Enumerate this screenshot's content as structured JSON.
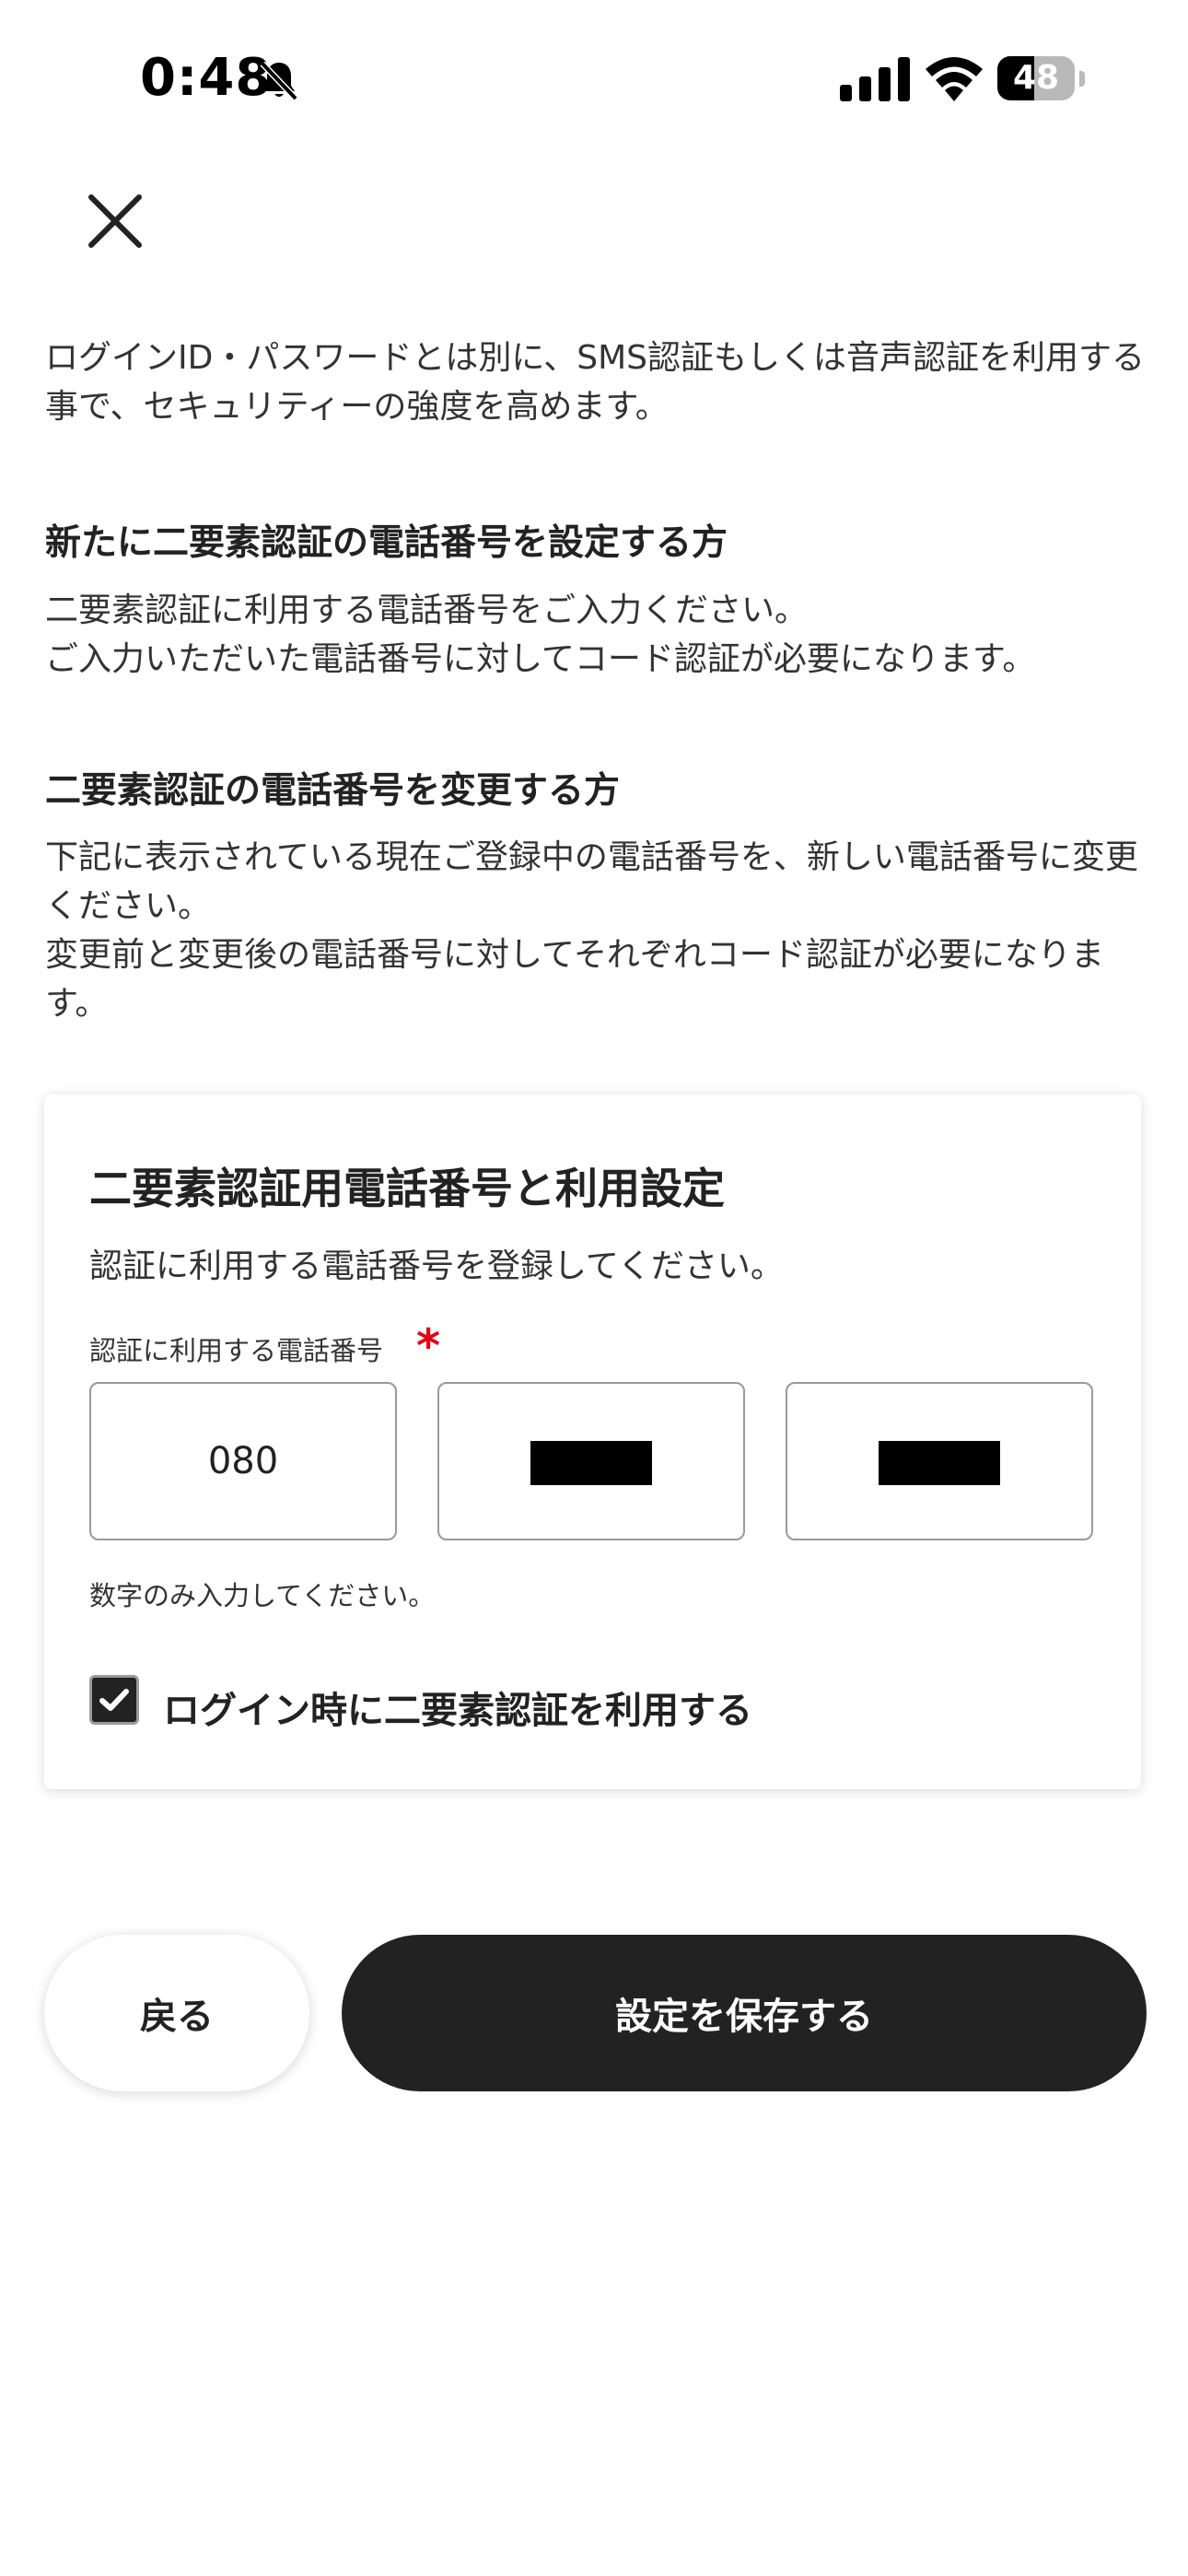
{
  "status_bar": {
    "time": "0:48",
    "battery_level": "48",
    "battery_fraction": 0.48,
    "icons": [
      "bell-slash-icon",
      "cellular-signal-icon",
      "wifi-icon",
      "battery-icon"
    ]
  },
  "header": {
    "close_icon": "close-icon"
  },
  "intro_text": "ログインID・パスワードとは別に、SMS認証もしくは音声認証を利用する事で、セキュリティーの強度を高めます。",
  "sections": [
    {
      "heading": "新たに二要素認証の電話番号を設定する方",
      "body_lines": [
        "二要素認証に利用する電話番号をご入力ください。",
        "ご入力いただいた電話番号に対してコード認証が必要になります。"
      ]
    },
    {
      "heading": "二要素認証の電話番号を変更する方",
      "body_lines": [
        "下記に表示されている現在ご登録中の電話番号を、新しい電話番号に変更ください。",
        "変更前と変更後の電話番号に対してそれぞれコード認証が必要になります。"
      ]
    }
  ],
  "card": {
    "title": "二要素認証用電話番号と利用設定",
    "description": "認証に利用する電話番号を登録してください。",
    "field_label": "認証に利用する電話番号",
    "required_mark": "*",
    "phone_fields": [
      {
        "value": "080",
        "redacted": false
      },
      {
        "value": "",
        "redacted": true
      },
      {
        "value": "",
        "redacted": true
      }
    ],
    "hint": "数字のみ入力してください。",
    "checkbox_label": "ログイン時に二要素認証を利用する",
    "checkbox_checked": true
  },
  "buttons": {
    "back_label": "戻る",
    "save_label": "設定を保存する"
  },
  "colors": {
    "text_primary": "#222222",
    "button_dark": "#222222",
    "required_red": "#e60012",
    "border_gray": "#9a9a9a"
  }
}
